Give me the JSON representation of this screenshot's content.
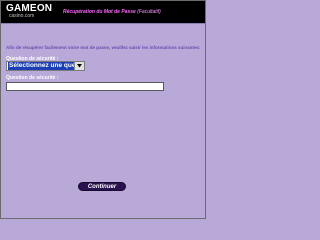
{
  "header": {
    "logo_main_1": "GAME",
    "logo_main_2": "ON",
    "logo_sub": "casino.com",
    "title": "Récupération du Mot de Passe",
    "title_suffix": "(Facultatif)"
  },
  "form": {
    "intro": "Afin de récupérer facilement votre mot de passe, veuillez saisir les informations suivantes:",
    "question_label": "Question de sécurité :",
    "question_selected": "Sélectionnez une question",
    "answer_label": "Question de sécurité :",
    "answer_value": ""
  },
  "actions": {
    "continue_label": "Continuer"
  },
  "colors": {
    "background": "#b8a9d9",
    "header": "#000000",
    "title": "#ff66ff",
    "intro_text": "#6a4bb0",
    "button": "#2a1250",
    "select_highlight": "#1c3fb5"
  },
  "icons": {
    "select_arrow": "chevron-down-icon"
  }
}
